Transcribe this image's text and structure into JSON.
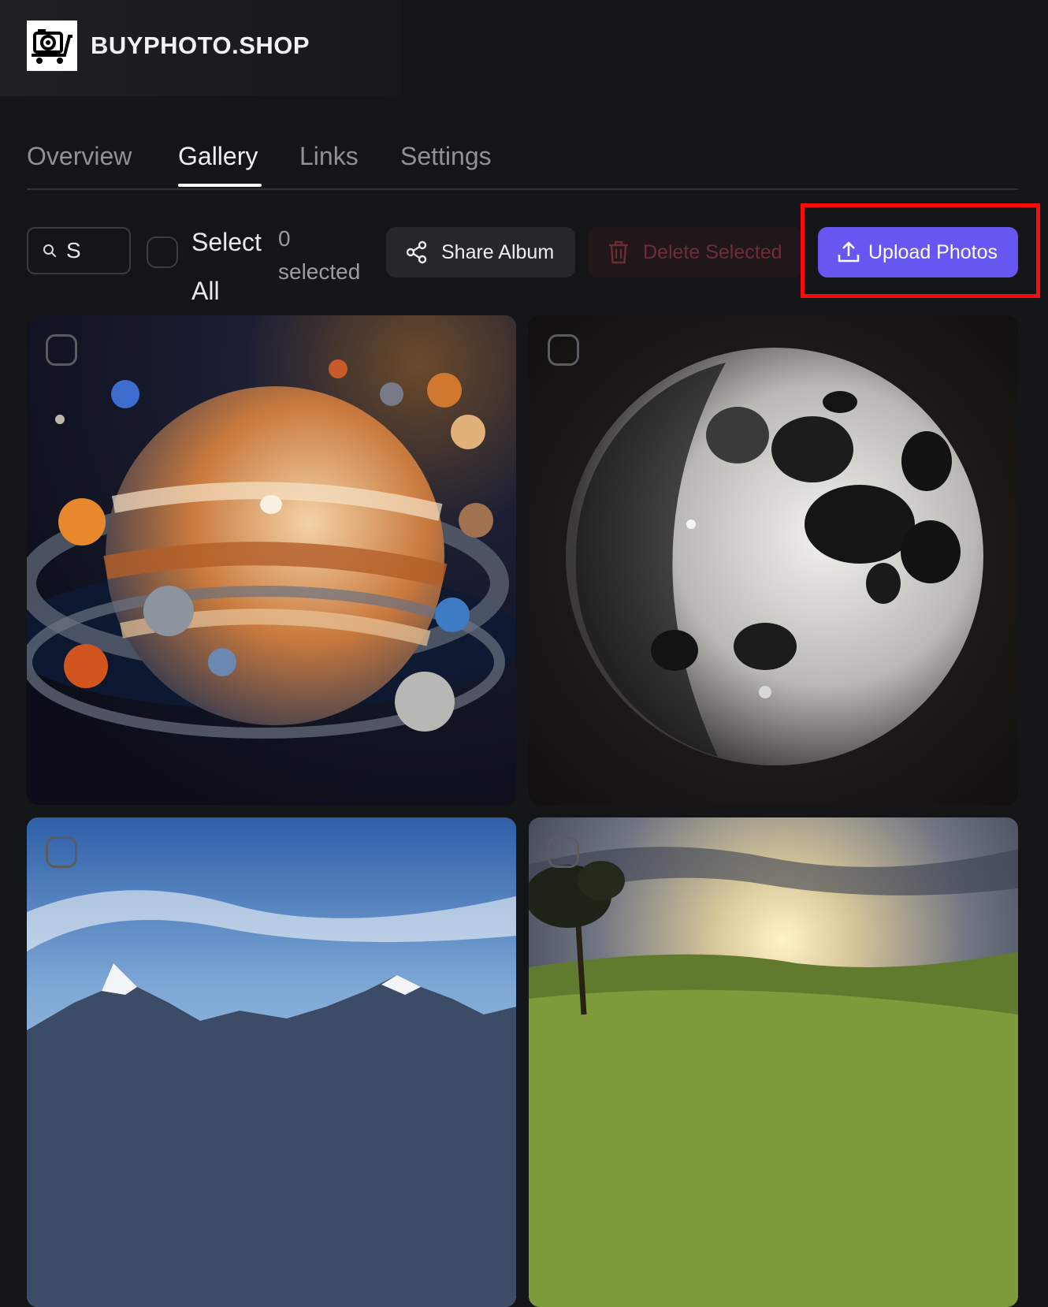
{
  "brand": {
    "name": "BUYPHOTO.SHOP",
    "logo_icon": "camera-cart-icon"
  },
  "tabs": [
    {
      "label": "Overview",
      "active": false
    },
    {
      "label": "Gallery",
      "active": true
    },
    {
      "label": "Links",
      "active": false
    },
    {
      "label": "Settings",
      "active": false
    }
  ],
  "toolbar": {
    "search_value": "S",
    "select_all_label": "Select All",
    "selected_count": "0",
    "selected_label": "selected",
    "share_label": "Share Album",
    "delete_label": "Delete Selected",
    "upload_label": "Upload Photos"
  },
  "colors": {
    "background": "#141517",
    "accent": "#6656f2",
    "delete_text": "#6e2c37",
    "highlight": "#ff0a0a"
  },
  "photos": [
    {
      "subject": "jupiter-planets",
      "selected": false
    },
    {
      "subject": "moon",
      "selected": false
    },
    {
      "subject": "mountains",
      "selected": false
    },
    {
      "subject": "sunset-hills",
      "selected": false
    }
  ]
}
